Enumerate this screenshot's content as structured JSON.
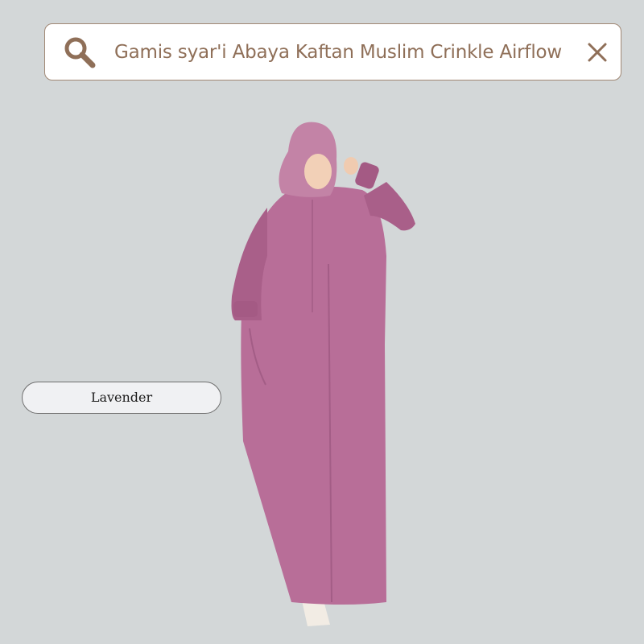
{
  "search": {
    "query": "Gamis syar'i Abaya Kaftan Muslim Crinkle Airflow"
  },
  "product": {
    "image_icon": "woman-in-abaya-dress",
    "dress_color": "#b86e98"
  },
  "variant": {
    "color_label": "Lavender"
  },
  "colors": {
    "background": "#d3d7d8",
    "search_border": "#a08774",
    "search_text": "#8f6f58",
    "chip_background": "#f0f1f3"
  },
  "icons": {
    "search": "search-icon",
    "clear": "close-icon"
  }
}
